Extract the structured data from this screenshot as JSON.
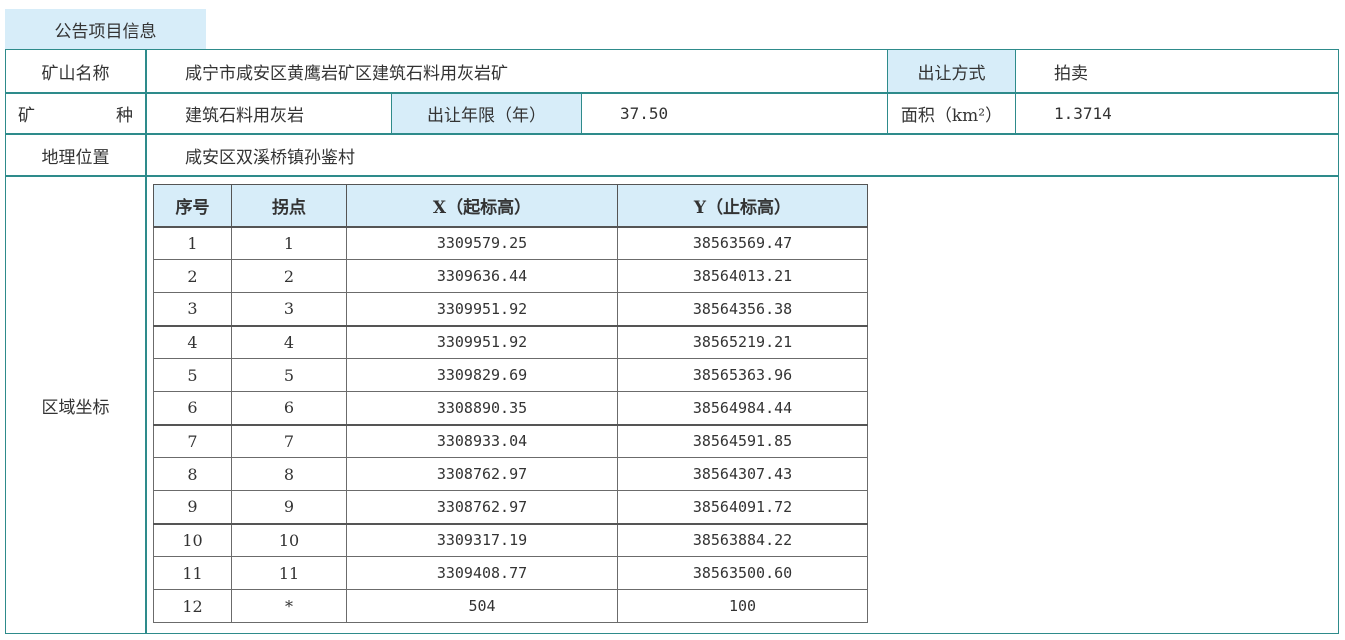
{
  "tab": {
    "label": "公告项目信息"
  },
  "info": {
    "mine_name_label": "矿山名称",
    "mine_name_value": "咸宁市咸安区黄鹰岩矿区建筑石料用灰岩矿",
    "transfer_method_label": "出让方式",
    "transfer_method_value": "拍卖",
    "mineral_label_left": "矿",
    "mineral_label_right": "种",
    "mineral_value": "建筑石料用灰岩",
    "term_label": "出让年限（年）",
    "term_value": "37.50",
    "area_label": "面积（km²）",
    "area_value": "1.3714",
    "location_label": "地理位置",
    "location_value": "咸安区双溪桥镇孙鉴村",
    "coords_label": "区域坐标"
  },
  "coords_table": {
    "headers": [
      "序号",
      "拐点",
      "X（起标高）",
      "Y（止标高）"
    ],
    "rows": [
      [
        "1",
        "1",
        "3309579.25",
        "38563569.47"
      ],
      [
        "2",
        "2",
        "3309636.44",
        "38564013.21"
      ],
      [
        "3",
        "3",
        "3309951.92",
        "38564356.38"
      ],
      [
        "4",
        "4",
        "3309951.92",
        "38565219.21"
      ],
      [
        "5",
        "5",
        "3309829.69",
        "38565363.96"
      ],
      [
        "6",
        "6",
        "3308890.35",
        "38564984.44"
      ],
      [
        "7",
        "7",
        "3308933.04",
        "38564591.85"
      ],
      [
        "8",
        "8",
        "3308762.97",
        "38564307.43"
      ],
      [
        "9",
        "9",
        "3308762.97",
        "38564091.72"
      ],
      [
        "10",
        "10",
        "3309317.19",
        "38563884.22"
      ],
      [
        "11",
        "11",
        "3309408.77",
        "38563500.60"
      ],
      [
        "12",
        "*",
        "504",
        "100"
      ]
    ]
  }
}
